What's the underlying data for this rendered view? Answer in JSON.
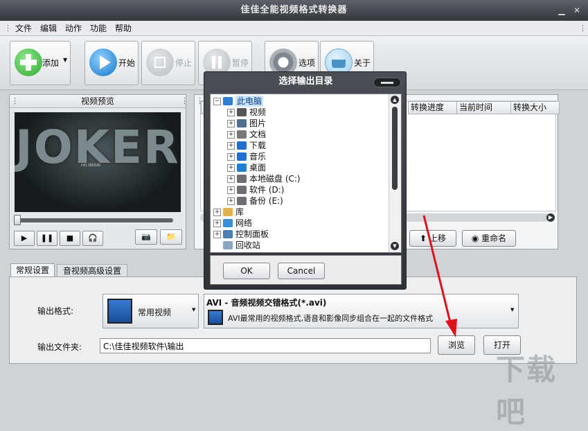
{
  "window": {
    "title": "佳佳全能视频格式转换器",
    "minimize": "▁",
    "close": "✕"
  },
  "menu": [
    "文件",
    "编辑",
    "动作",
    "功能",
    "帮助"
  ],
  "toolbar": {
    "add": "添加",
    "start": "开始",
    "stop": "停止",
    "pause": "暂停",
    "options": "选项",
    "about": "关于"
  },
  "preview": {
    "title": "视频预览",
    "poster_text": "JOKER",
    "poster_caption": "HIS ORIGIN"
  },
  "list": {
    "columns": [
      "转换进度",
      "当前时间",
      "转换大小"
    ],
    "move_up": "上移",
    "rename": "重命名"
  },
  "tabs": [
    "常规设置",
    "音视频高级设置"
  ],
  "settings": {
    "output_format_label": "输出格式:",
    "format_category": "常用视频",
    "format_title": "AVI - 音频视频交错格式(*.avi)",
    "format_desc": "AVI最常用的视频格式,语音和影像同步组合在一起的文件格式",
    "output_folder_label": "输出文件夹:",
    "output_folder_value": "C:\\佳佳视频软件\\输出",
    "browse": "浏览",
    "open": "打开"
  },
  "dialog": {
    "title": "选择输出目录",
    "ok": "OK",
    "cancel": "Cancel",
    "tree": [
      {
        "label": "此电脑",
        "depth": 0,
        "expander": "⊟",
        "icon": "computer-icon"
      },
      {
        "label": "视频",
        "depth": 1,
        "expander": "⊞",
        "icon": "video-folder-icon"
      },
      {
        "label": "图片",
        "depth": 1,
        "expander": "⊞",
        "icon": "pictures-folder-icon"
      },
      {
        "label": "文档",
        "depth": 1,
        "expander": "⊞",
        "icon": "documents-folder-icon"
      },
      {
        "label": "下载",
        "depth": 1,
        "expander": "⊞",
        "icon": "download-icon"
      },
      {
        "label": "音乐",
        "depth": 1,
        "expander": "⊞",
        "icon": "music-icon"
      },
      {
        "label": "桌面",
        "depth": 1,
        "expander": "⊞",
        "icon": "desktop-icon"
      },
      {
        "label": "本地磁盘 (C:)",
        "depth": 1,
        "expander": "⊞",
        "icon": "drive-icon"
      },
      {
        "label": "软件 (D:)",
        "depth": 1,
        "expander": "⊞",
        "icon": "drive-icon"
      },
      {
        "label": "备份 (E:)",
        "depth": 1,
        "expander": "⊞",
        "icon": "drive-icon"
      },
      {
        "label": "库",
        "depth": 0,
        "expander": "⊞",
        "icon": "library-icon"
      },
      {
        "label": "网络",
        "depth": 0,
        "expander": "⊞",
        "icon": "network-icon"
      },
      {
        "label": "控制面板",
        "depth": 0,
        "expander": "⊞",
        "icon": "control-panel-icon"
      },
      {
        "label": "回收站",
        "depth": 0,
        "expander": "",
        "icon": "recycle-bin-icon"
      }
    ]
  },
  "watermark": "下载吧"
}
